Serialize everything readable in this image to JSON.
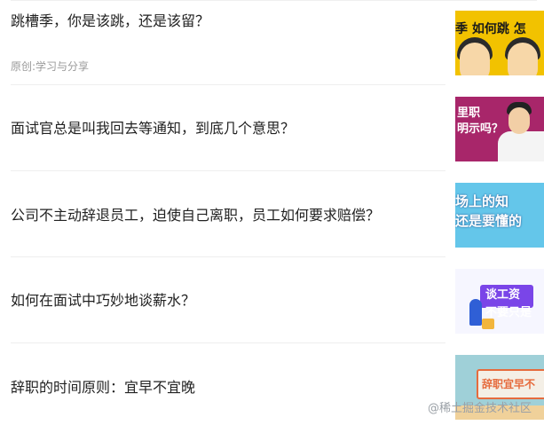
{
  "articles": [
    {
      "title": "跳槽季，你是该跳，还是该留？",
      "meta": "原创:学习与分享",
      "thumb_text": "季 如何跳 怎"
    },
    {
      "title": "面试官总是叫我回去等通知，到底几个意思？",
      "meta": "",
      "thumb_text": "里职\n明示吗？"
    },
    {
      "title": "公司不主动辞退员工，迫使自己离职，员工如何要求赔偿？",
      "meta": "",
      "thumb_text": "场上的知\n还是要懂的"
    },
    {
      "title": "如何在面试中巧妙地谈薪水？",
      "meta": "",
      "thumb_text": "谈工资\n不要只是"
    },
    {
      "title": "辞职的时间原则：宜早不宜晚",
      "meta": "",
      "thumb_text": "辞职宜早不"
    }
  ],
  "watermark": "@稀土掘金技术社区",
  "colors": {
    "title": "#222222",
    "meta": "#9a9a9a",
    "divider": "#eeeeee"
  }
}
